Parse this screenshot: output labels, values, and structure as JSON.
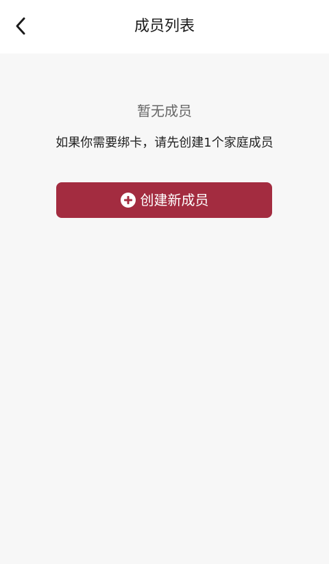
{
  "header": {
    "title": "成员列表",
    "back_icon": "chevron-left-icon"
  },
  "empty_state": {
    "title": "暂无成员",
    "hint": "如果你需要绑卡，请先创建1个家庭成员"
  },
  "create_button": {
    "label": "创建新成员",
    "icon": "plus-circle-icon",
    "color": "#a32c40"
  },
  "colors": {
    "background": "#f7f7f7",
    "header_background": "#ffffff"
  }
}
